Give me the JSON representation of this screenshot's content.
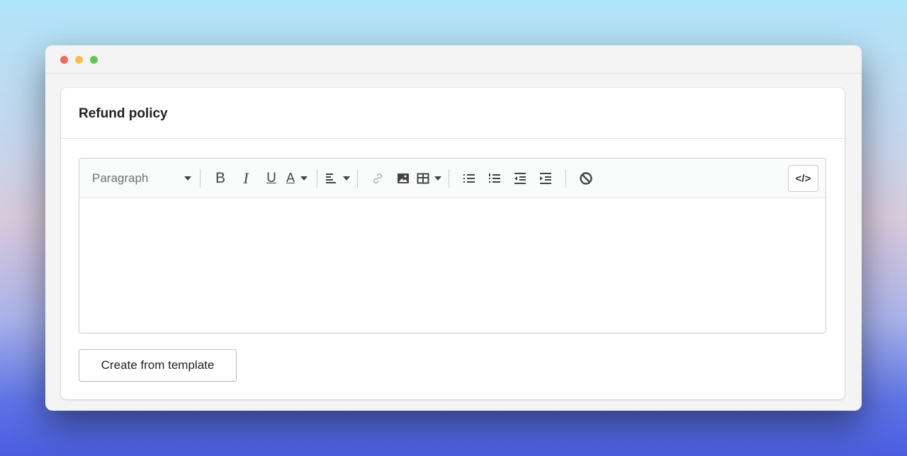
{
  "card": {
    "title": "Refund policy"
  },
  "toolbar": {
    "format_select": "Paragraph",
    "bold": "B",
    "italic": "I",
    "underline": "U",
    "text_color": "A",
    "code_view": "</>"
  },
  "actions": {
    "create_from_template": "Create from template"
  },
  "colors": {
    "close": "#ed6a5e",
    "minimize": "#f5bf4f",
    "maximize": "#61c554"
  }
}
